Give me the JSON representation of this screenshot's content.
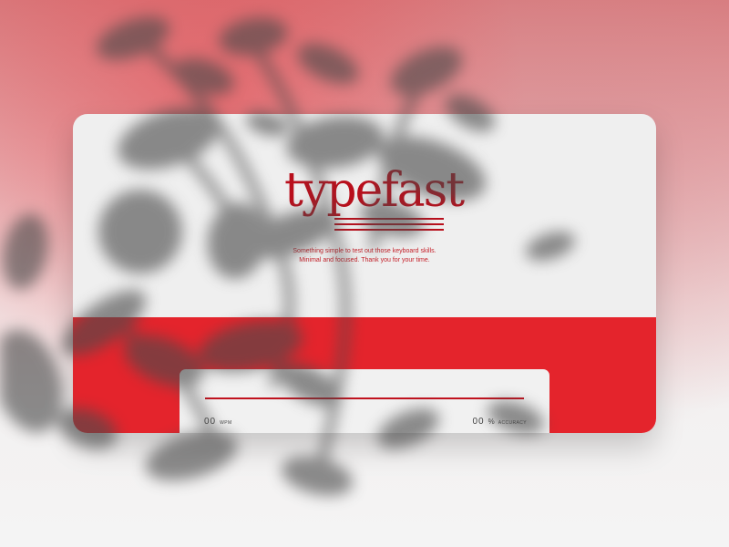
{
  "app": {
    "logo_text": "typefast",
    "tagline_line_1": "Something simple to test out those keyboard skills.",
    "tagline_line_2": "Minimal and focused. Thank you for your time."
  },
  "stats": {
    "wpm_value": "00",
    "wpm_label": "WPM",
    "accuracy_value": "00",
    "accuracy_symbol": "%",
    "accuracy_label": "ACCURACY"
  },
  "colors": {
    "accent": "#e4242c",
    "brand": "#b90f1c",
    "card": "#efefef"
  }
}
